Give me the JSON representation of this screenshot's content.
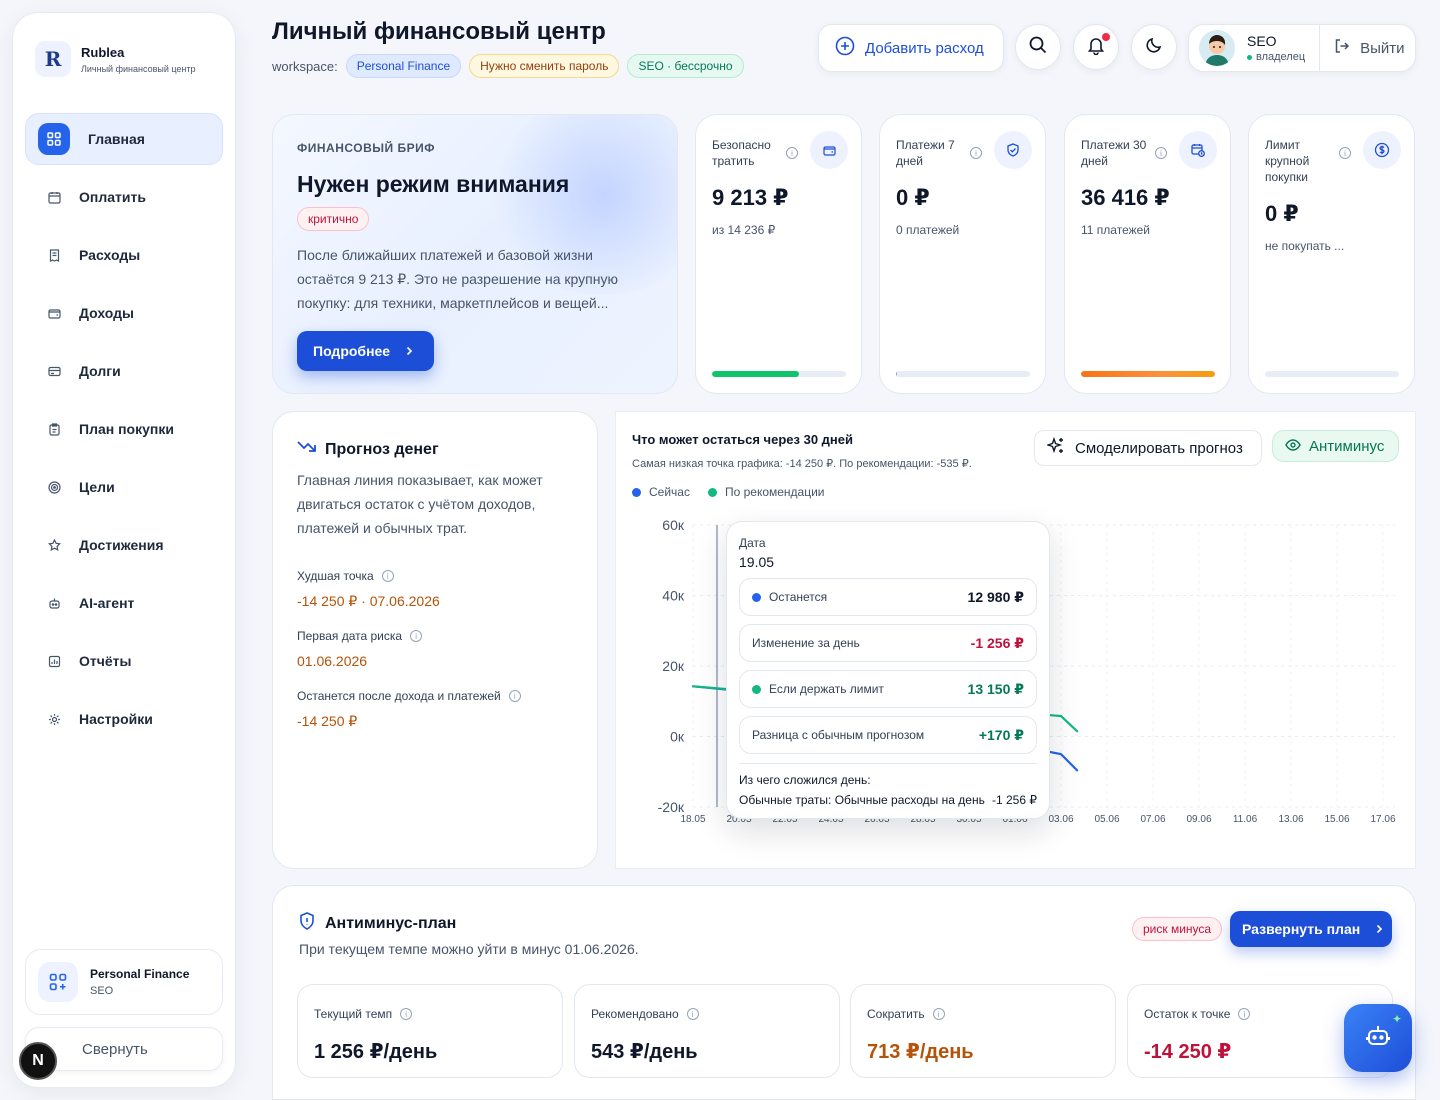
{
  "brand": {
    "name": "Rublea",
    "subtitle": "Личный финансовый центр",
    "logo": "R"
  },
  "nav": [
    {
      "label": "Главная",
      "icon": "grid-icon",
      "active": true
    },
    {
      "label": "Оплатить",
      "icon": "calendar-icon"
    },
    {
      "label": "Расходы",
      "icon": "receipt-icon"
    },
    {
      "label": "Доходы",
      "icon": "wallet-icon"
    },
    {
      "label": "Долги",
      "icon": "card-icon"
    },
    {
      "label": "План покупки",
      "icon": "clipboard-icon"
    },
    {
      "label": "Цели",
      "icon": "target-icon"
    },
    {
      "label": "Достижения",
      "icon": "trophy-icon"
    },
    {
      "label": "AI-агент",
      "icon": "robot-icon"
    },
    {
      "label": "Отчёты",
      "icon": "report-icon"
    },
    {
      "label": "Настройки",
      "icon": "gear-icon"
    }
  ],
  "workspace_card": {
    "name": "Personal Finance",
    "user": "SEO"
  },
  "collapse_label": "Свернуть",
  "n_badge": "N",
  "header": {
    "title": "Личный финансовый центр",
    "workspace_label": "workspace:",
    "chips": [
      "Personal Finance",
      "Нужно сменить пароль",
      "SEO · бессрочно"
    ],
    "add_expense": "Добавить расход",
    "user_name": "SEO",
    "user_role": "владелец",
    "logout": "Выйти"
  },
  "brief": {
    "label": "ФИНАНСОВЫЙ БРИФ",
    "title": "Нужен режим внимания",
    "status": "критично",
    "text": "После ближайших платежей и базовой жизни остаётся 9 213 ₽. Это не разрешение на крупную покупку: для техники, маркетплейсов и вещей...",
    "button": "Подробнее"
  },
  "stats": [
    {
      "label": "Безопасно тратить",
      "value": "9 213 ₽",
      "sub": "из 14 236 ₽",
      "icon": "wallet-icon",
      "progress": 0.65,
      "color": "#10c46e"
    },
    {
      "label": "Платежи 7 дней",
      "value": "0 ₽",
      "sub": "0 платежей",
      "icon": "shield-check-icon",
      "progress": 0.01,
      "color": "#94a3b8"
    },
    {
      "label": "Платежи 30 дней",
      "value": "36 416 ₽",
      "sub": "11 платежей",
      "icon": "calendar-clock-icon",
      "progress": 1.0,
      "color": "#f97316"
    },
    {
      "label": "Лимит крупной покупки",
      "value": "0 ₽",
      "sub": "не покупать ...",
      "icon": "dollar-icon",
      "progress": 0,
      "color": "#94a3b8"
    }
  ],
  "forecast": {
    "title": "Прогноз денег",
    "description": "Главная линия показывает, как может двигаться остаток с учётом доходов, платежей и обычных трат.",
    "items": [
      {
        "label": "Худшая точка",
        "value": "-14 250 ₽ · 07.06.2026"
      },
      {
        "label": "Первая дата риска",
        "value": "01.06.2026"
      },
      {
        "label": "Останется после дохода и платежей",
        "value": "-14 250 ₽"
      }
    ]
  },
  "chart": {
    "title": "Что может остаться через 30 дней",
    "subtitle": "Самая низкая точка графика: -14 250 ₽. По рекомендации: -535 ₽.",
    "model_button": "Смоделировать прогноз",
    "anti_button": "Антиминус",
    "tooltip": {
      "date_label": "Дата",
      "date": "19.05",
      "rows": [
        {
          "label": "Останется",
          "value": "12 980 ₽",
          "dot": "#2563eb",
          "color": "#0f172a"
        },
        {
          "label": "Изменение за день",
          "value": "-1 256 ₽",
          "dot": null,
          "color": "#be123c"
        },
        {
          "label": "Если держать лимит",
          "value": "13 150 ₽",
          "dot": "#10b981",
          "color": "#047857"
        },
        {
          "label": "Разница с обычным прогнозом",
          "value": "+170 ₽",
          "dot": null,
          "color": "#047857"
        }
      ],
      "source_label": "Из чего сложился день:",
      "source_item": "Обычные траты: Обычные расходы на день",
      "source_value": "-1 256 ₽"
    }
  },
  "chart_data": {
    "type": "line",
    "categories": [
      "18.05",
      "20.05",
      "22.05",
      "24.05",
      "26.05",
      "28.05",
      "30.05",
      "01.06",
      "03.06",
      "05.06",
      "07.06",
      "09.06",
      "11.06",
      "13.06",
      "15.06",
      "17.06"
    ],
    "yticks": [
      "60к",
      "40к",
      "20к",
      "0к",
      "-20к"
    ],
    "ylim": [
      -20000,
      60000
    ],
    "legend_position": "top-left",
    "grid": true,
    "series": [
      {
        "name": "Сейчас",
        "color": "#2563eb",
        "points": [
          [
            0,
            14236
          ],
          [
            1,
            12980
          ],
          [
            8,
            -5000
          ],
          [
            8.35,
            -9600
          ]
        ]
      },
      {
        "name": "По рекомендации",
        "color": "#10b981",
        "points": [
          [
            0,
            14236
          ],
          [
            1,
            13150
          ],
          [
            8,
            5800
          ],
          [
            8.35,
            1500
          ]
        ]
      }
    ],
    "hover_index": 1
  },
  "anti": {
    "title": "Антиминус-план",
    "subtitle": "При текущем темпе можно уйти в минус 01.06.2026.",
    "risk_chip": "риск минуса",
    "expand_button": "Развернуть план",
    "metrics": [
      {
        "label": "Текущий темп",
        "value": "1 256 ₽/день",
        "color": "#0f172a"
      },
      {
        "label": "Рекомендовано",
        "value": "543 ₽/день",
        "color": "#0f172a"
      },
      {
        "label": "Сократить",
        "value": "713 ₽/день",
        "color": "#b45309"
      },
      {
        "label": "Остаток к точке",
        "value": "-14 250 ₽",
        "color": "#be123c"
      }
    ]
  }
}
